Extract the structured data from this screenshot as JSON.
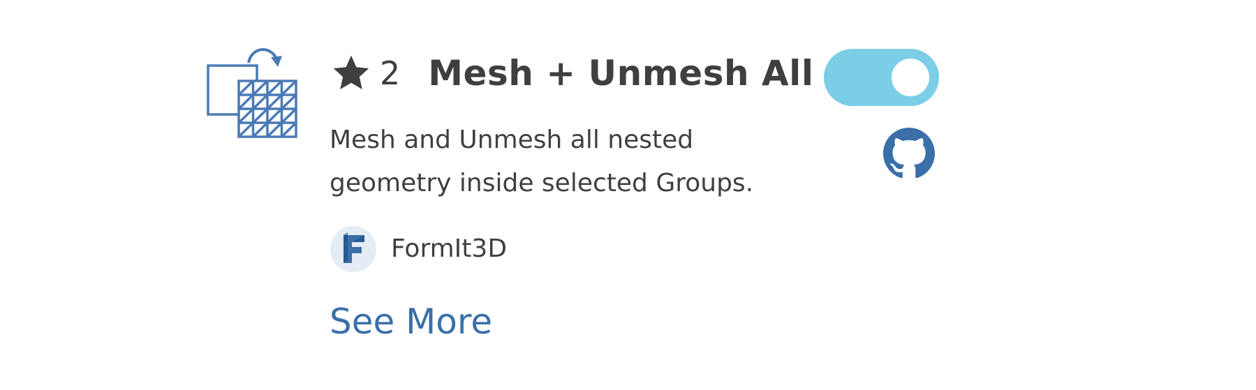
{
  "plugin": {
    "icon": "mesh-unmesh-icon",
    "star_icon": "star-icon",
    "star_count": "2",
    "title": "Mesh + Unmesh All",
    "description": "Mesh and Unmesh all nested geometry inside selected Groups.",
    "toggle": {
      "state": "on",
      "color": "#7ccde6"
    },
    "repo_icon": "github-icon",
    "author": {
      "logo": "formit-logo-icon",
      "name": "FormIt3D"
    },
    "see_more_label": "See More"
  },
  "colors": {
    "text": "#3f3f3f",
    "link": "#3a6fa8",
    "icon_blue": "#4a7ab5",
    "toggle_on": "#7ccde6"
  }
}
